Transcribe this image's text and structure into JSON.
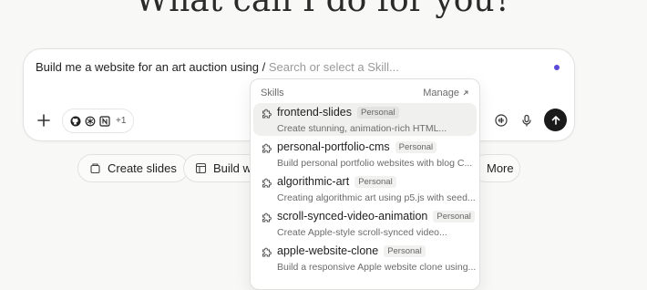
{
  "headline": "What can I do for you?",
  "composer": {
    "prompt_text": "Build me a website for an art auction using / ",
    "search_placeholder": "Search or select a Skill...",
    "connector_more": "+1"
  },
  "dropdown": {
    "title": "Skills",
    "manage_label": "Manage",
    "skills": [
      {
        "name": "frontend-slides",
        "badge": "Personal",
        "desc": "Create stunning, animation-rich HTML..."
      },
      {
        "name": "personal-portfolio-cms",
        "badge": "Personal",
        "desc": "Build personal portfolio websites with blog C..."
      },
      {
        "name": "algorithmic-art",
        "badge": "Personal",
        "desc": "Creating algorithmic art using p5.js with seed..."
      },
      {
        "name": "scroll-synced-video-animation",
        "badge": "Personal",
        "desc": "Create Apple-style scroll-synced video..."
      },
      {
        "name": "apple-website-clone",
        "badge": "Personal",
        "desc": "Build a responsive Apple website clone using..."
      }
    ]
  },
  "chips": [
    {
      "label": "Create slides",
      "icon": "slides-icon"
    },
    {
      "label": "Build we",
      "icon": "web-icon"
    },
    {
      "label": "More",
      "icon": "none"
    }
  ],
  "colors": {
    "accent_dot": "#5b4bd6",
    "send_button": "#1a1a1a"
  }
}
